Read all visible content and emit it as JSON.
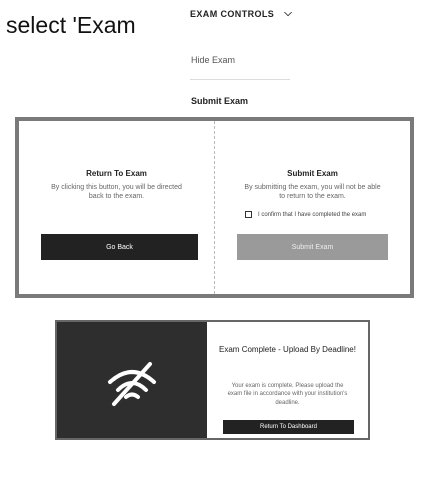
{
  "instruction": "select 'Exam",
  "controls": {
    "toggle_label": "EXAM CONTROLS",
    "hide_label": "Hide Exam",
    "submit_label": "Submit Exam"
  },
  "return_pane": {
    "title": "Return To Exam",
    "text": "By clicking this button, you will be directed back to the exam.",
    "button": "Go Back"
  },
  "submit_pane": {
    "title": "Submit Exam",
    "text": "By submitting the exam, you will not be able to return to the exam.",
    "checkbox_label": "I confirm that I have completed the exam",
    "button": "Submit Exam"
  },
  "complete": {
    "title": "Exam Complete - Upload By Deadline!",
    "text": "Your exam is complete. Please upload the exam file in accordance with your institution's deadline.",
    "button": "Return To Dashboard"
  },
  "icons": {
    "chevron": "chevron-down-icon",
    "wifi_off": "wifi-off-icon"
  },
  "colors": {
    "dark_button": "#222222",
    "disabled_button": "#9a9a9a",
    "dark_panel": "#2e2e2e"
  }
}
